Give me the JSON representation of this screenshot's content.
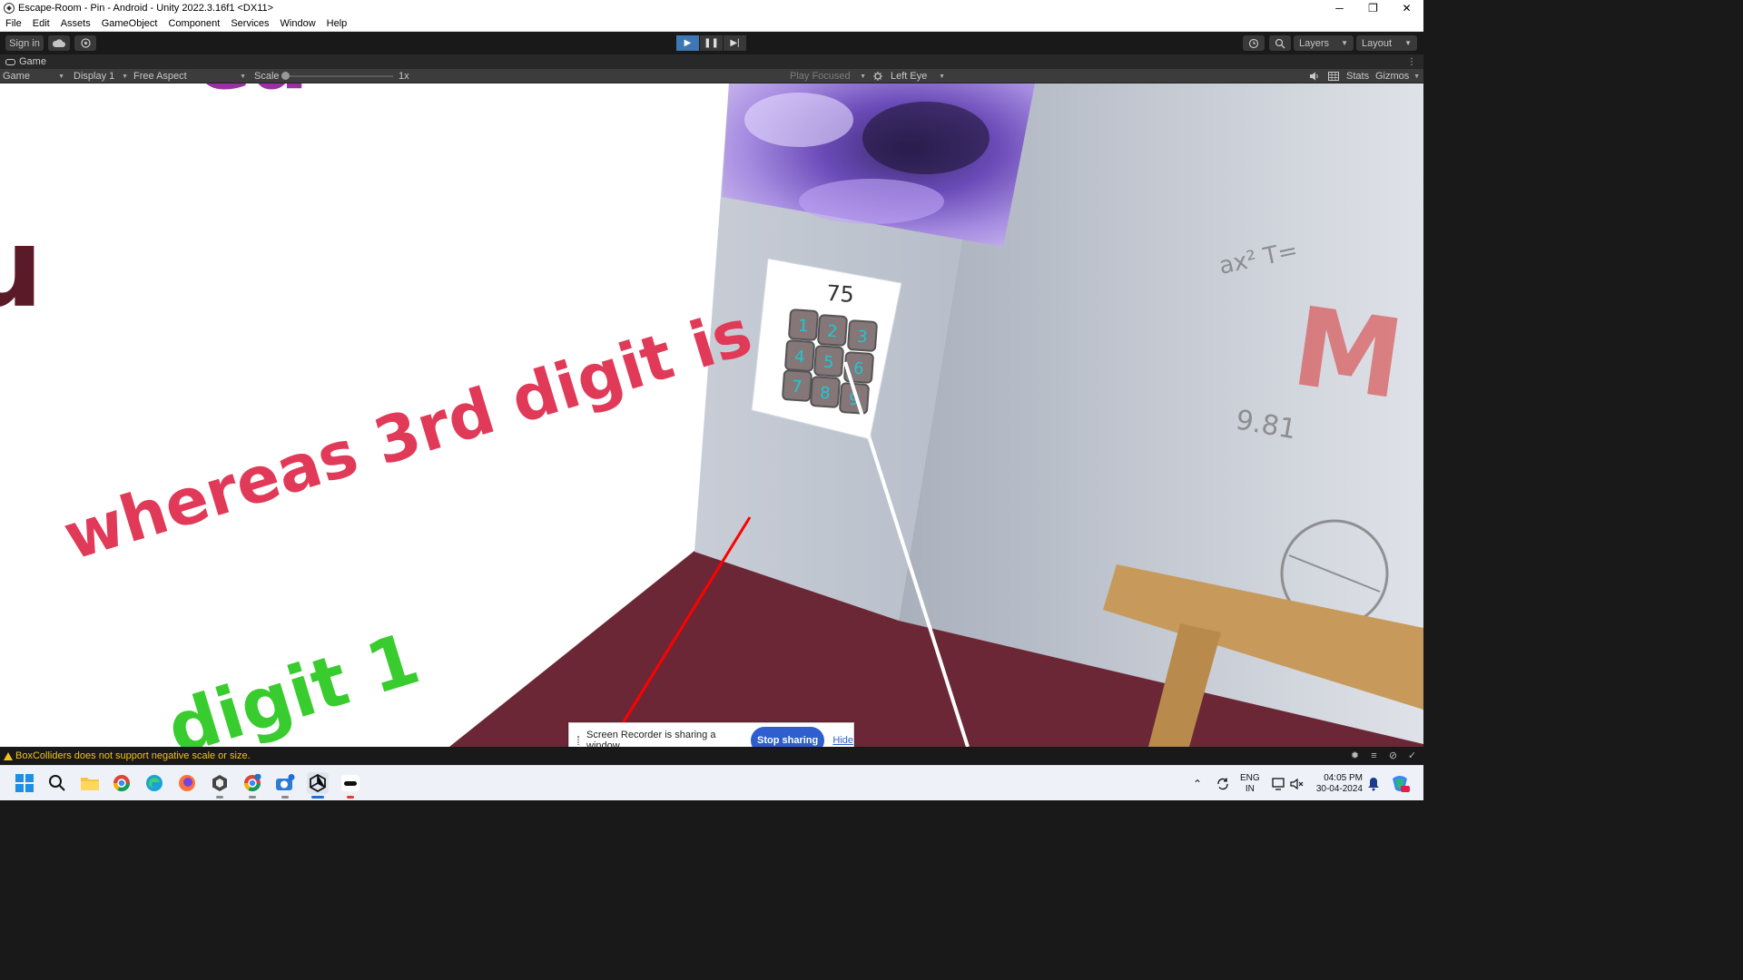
{
  "window": {
    "title": "Escape-Room - Pin - Android - Unity 2022.3.16f1 <DX11>",
    "controls": {
      "minimize": "─",
      "maximize": "❐",
      "close": "✕"
    }
  },
  "menu": [
    "File",
    "Edit",
    "Assets",
    "GameObject",
    "Component",
    "Services",
    "Window",
    "Help"
  ],
  "toolbar": {
    "sign_in": "Sign in",
    "layers": "Layers",
    "layout": "Layout"
  },
  "game_tab": {
    "label": "Game"
  },
  "game_header": {
    "view": "Game",
    "display": "Display 1",
    "aspect": "Free Aspect",
    "scale_label": "Scale",
    "scale_value": "1x",
    "play_focused": "Play Focused",
    "eye": "Left Eye",
    "stats": "Stats",
    "gizmos": "Gizmos"
  },
  "scene": {
    "wall_text_1": "whereas 3rd digit is",
    "wall_text_2": "digit 1",
    "keypad_display": "75",
    "keypad_keys": [
      "1",
      "2",
      "3",
      "4",
      "5",
      "6",
      "7",
      "8",
      "9"
    ],
    "colors": {
      "floor": "#6b2736",
      "red_text": "#e03a58",
      "green_text": "#38cc2e",
      "key_digit": "#1ec8d2",
      "wall_grey": "#c3c8d0"
    }
  },
  "screen_recorder": {
    "message": "Screen Recorder is sharing a window.",
    "stop": "Stop sharing",
    "hide": "Hide"
  },
  "status": {
    "warning": "BoxColliders does not support negative scale or size."
  },
  "taskbar": {
    "lang_line1": "ENG",
    "lang_line2": "IN",
    "time": "04:05 PM",
    "date": "30-04-2024"
  }
}
